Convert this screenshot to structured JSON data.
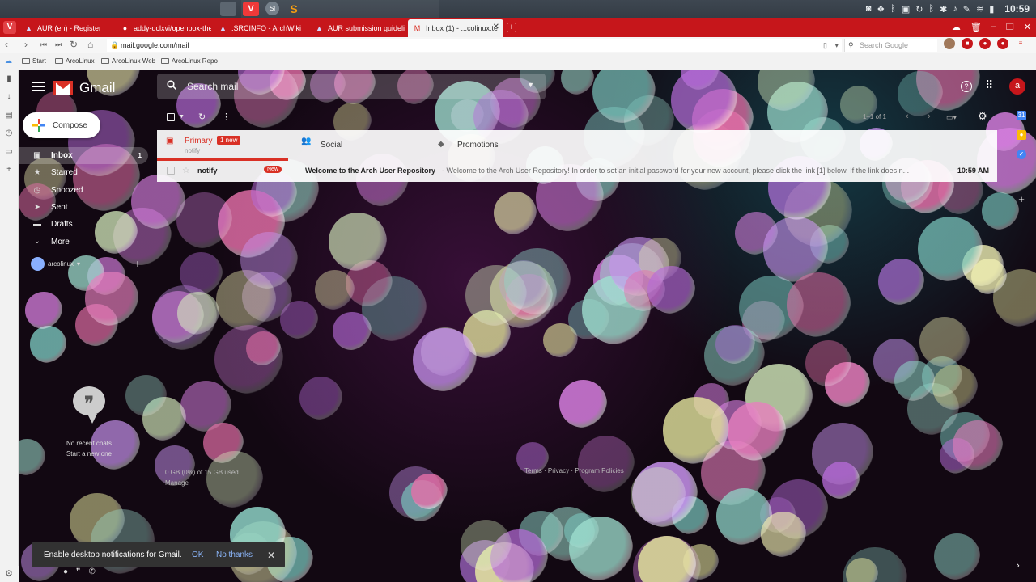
{
  "os_panel": {
    "clock": "10:59",
    "launchers": [
      "files-icon",
      "vivaldi-icon",
      "sl-icon",
      "sublime-icon"
    ],
    "tray_icons": [
      "camera-icon",
      "dropbox-icon",
      "bluetooth-icon",
      "screen-icon",
      "sync-icon",
      "bluetooth-icon",
      "settings-icon",
      "volume-icon",
      "notes-icon",
      "wifi-icon",
      "battery-icon"
    ]
  },
  "browser": {
    "tabs": [
      {
        "label": "AUR (en) - Register",
        "icon": "arch-icon"
      },
      {
        "label": "addy-dclxvi/openbox-them",
        "icon": "github-icon"
      },
      {
        "label": ".SRCINFO - ArchWiki",
        "icon": "arch-icon"
      },
      {
        "label": "AUR submission guideline",
        "icon": "arch-icon"
      },
      {
        "label": "Inbox (1) - ...colinux.te",
        "icon": "gmail-icon"
      }
    ],
    "url": "mail.google.com/mail",
    "search_placeholder": "Search Google",
    "bookmarks": [
      "Start",
      "ArcoLinux",
      "ArcoLinux Web",
      "ArcoLinux Repo"
    ]
  },
  "gmail": {
    "brand": "Gmail",
    "search_placeholder": "Search mail",
    "compose_label": "Compose",
    "avatar_letter": "a",
    "nav": [
      {
        "label": "Inbox",
        "count": "1",
        "icon": "inbox-icon"
      },
      {
        "label": "Starred",
        "count": "",
        "icon": "star-icon"
      },
      {
        "label": "Snoozed",
        "count": "",
        "icon": "clock-icon"
      },
      {
        "label": "Sent",
        "count": "",
        "icon": "send-icon"
      },
      {
        "label": "Drafts",
        "count": "",
        "icon": "draft-icon"
      },
      {
        "label": "More",
        "count": "",
        "icon": "chevron-down-icon"
      }
    ],
    "hangouts_user": "arcolinux",
    "pager": "1–1 of 1",
    "categories": [
      {
        "label": "Primary",
        "badge": "1 new",
        "sub": "notify"
      },
      {
        "label": "Social",
        "badge": "",
        "sub": ""
      },
      {
        "label": "Promotions",
        "badge": "",
        "sub": ""
      }
    ],
    "emails": [
      {
        "sender": "notify",
        "tag": "New",
        "subject": "Welcome to the Arch User Repository",
        "snippet": " - Welcome to the Arch User Repository! In order to set an initial password for your new account, please click the link [1] below. If the link does n...",
        "time": "10:59 AM"
      }
    ],
    "hangouts_empty": {
      "line1": "No recent chats",
      "line2": "Start a new one"
    },
    "storage": {
      "used": "0 GB (0%) of 15 GB used",
      "manage": "Manage"
    },
    "footer": "Terms · Privacy · Program Policies",
    "snackbar": {
      "text": "Enable desktop notifications for Gmail.",
      "ok": "OK",
      "no": "No thanks"
    }
  },
  "colors": {
    "browser_red": "#c6161b",
    "gmail_red": "#d93025",
    "link_blue": "#8ab4f8"
  }
}
